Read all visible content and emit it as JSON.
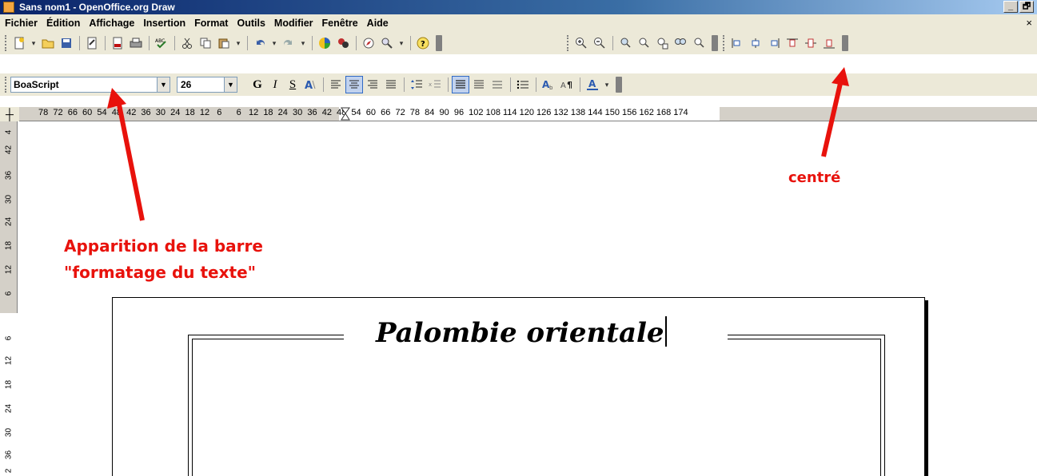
{
  "window": {
    "title": "Sans nom1 - OpenOffice.org Draw",
    "controls": [
      "_",
      "🗗"
    ]
  },
  "menu": {
    "items": [
      "Fichier",
      "Édition",
      "Affichage",
      "Insertion",
      "Format",
      "Outils",
      "Modifier",
      "Fenêtre",
      "Aide"
    ],
    "close": "×"
  },
  "text_toolbar": {
    "font_name": "BoaScript",
    "font_size": "26",
    "bold": "G",
    "italic": "I",
    "shadow": "S"
  },
  "ruler": {
    "horizontal": "78  72  66  60  54  48  42  36  30  24  18  12   6      6   12  18  24  30  36  42  48  54  60  66  72  78  84  90  96  102 108 114 120 126 132 138 144 150 156 162 168 174",
    "vertical_top": [
      "4",
      "42",
      "36",
      "30",
      "24",
      "18",
      "12",
      "6"
    ],
    "vertical_bottom": [
      "6",
      "12",
      "18",
      "24",
      "30",
      "36",
      "2"
    ]
  },
  "document": {
    "title_text": "Palombie orientale"
  },
  "annotations": {
    "toolbar_note_line1": "Apparition de la barre",
    "toolbar_note_line2": "\"formatage du texte\"",
    "center_note": "centré",
    "color": "#e8120c"
  }
}
